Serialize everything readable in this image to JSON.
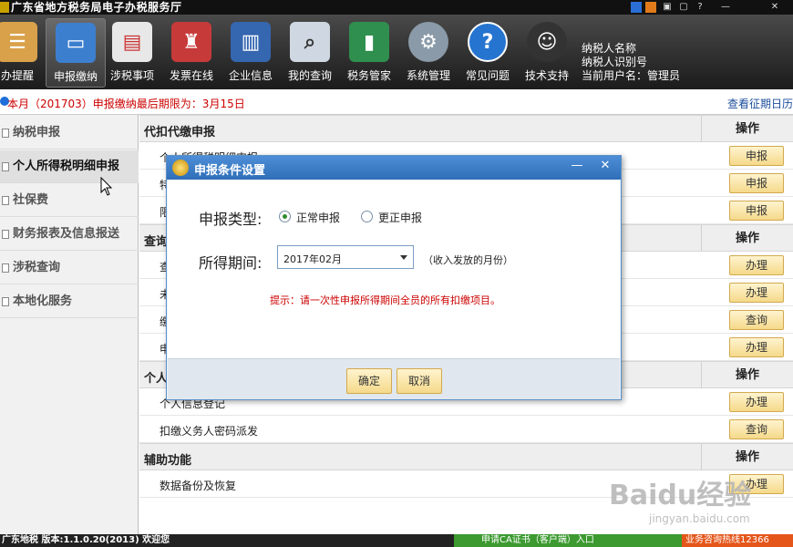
{
  "window": {
    "title": "广东省地方税务局电子办税服务厅",
    "controls": [
      "■",
      "■",
      "▣",
      "▢",
      "?",
      "—",
      "✕"
    ]
  },
  "toolbar": {
    "items": [
      {
        "label": "办提醒",
        "icon": "clipboard-icon"
      },
      {
        "label": "申报缴纳",
        "icon": "monitor-icon"
      },
      {
        "label": "涉税事项",
        "icon": "document-icon"
      },
      {
        "label": "发票在线",
        "icon": "stamp-icon"
      },
      {
        "label": "企业信息",
        "icon": "building-icon"
      },
      {
        "label": "我的查询",
        "icon": "magnifier-icon"
      },
      {
        "label": "税务管家",
        "icon": "bar-chart-icon"
      },
      {
        "label": "系统管理",
        "icon": "gear-icon"
      },
      {
        "label": "常见问题",
        "icon": "help-icon"
      },
      {
        "label": "技术支持",
        "icon": "support-agent-icon"
      }
    ],
    "active_index": 1
  },
  "user": {
    "line1": "纳税人名称",
    "line2": "纳税人识别号",
    "line3": "当前用户名：管理员"
  },
  "notice": {
    "text": "本月（201703）申报缴纳最后期限为：3月15日",
    "link": "查看征期日历"
  },
  "sidebar": {
    "items": [
      {
        "label": "纳税申报"
      },
      {
        "label": "个人所得税明细申报"
      },
      {
        "label": "社保费"
      },
      {
        "label": "财务报表及信息报送"
      },
      {
        "label": "涉税查询"
      },
      {
        "label": "本地化服务"
      }
    ],
    "active_index": 1
  },
  "content": {
    "sections": [
      {
        "title": "代扣代缴申报",
        "op": "操作",
        "rows": [
          {
            "text": "个人所得税明细申报",
            "btn": "申报"
          },
          {
            "text": "特",
            "btn": "申报"
          },
          {
            "text": "限",
            "btn": "申报"
          }
        ]
      },
      {
        "title": "查询",
        "op": "操作",
        "rows": [
          {
            "text": "查",
            "btn": "办理"
          },
          {
            "text": "未",
            "btn": "办理"
          },
          {
            "text": "缴",
            "btn": "查询"
          },
          {
            "text": "申",
            "btn": "办理"
          }
        ]
      },
      {
        "title": "个人",
        "op": "操作",
        "rows": [
          {
            "text": "个人信息登记",
            "btn": "办理"
          },
          {
            "text": "扣缴义务人密码派发",
            "btn": "查询"
          }
        ]
      },
      {
        "title": "辅助功能",
        "op": "操作",
        "rows": [
          {
            "text": "数据备份及恢复",
            "btn": "办理"
          }
        ]
      }
    ]
  },
  "dialog": {
    "title": "申报条件设置",
    "type_label": "申报类型:",
    "options": [
      "正常申报",
      "更正申报"
    ],
    "selected_option": 0,
    "period_label": "所得期间:",
    "period_value": "2017年02月",
    "period_hint": "（收入发放的月份）",
    "tip": "提示：请一次性申报所得期间全员的所有扣缴项目。",
    "ok": "确定",
    "cancel": "取消"
  },
  "statusbar": {
    "left": "广东地税 版本:1.1.0.20(2013) 欢迎您",
    "middle": "申请CA证书（客户端）入口",
    "right": "业务咨询热线12366"
  },
  "watermark": {
    "line1": "Baidu经验",
    "line2": "jingyan.baidu.com"
  },
  "colors": {
    "toolbar_bg": "#2a2a2a",
    "dialog_title": "#3a7bc8",
    "button_gold": "#f5d98a",
    "tip_red": "#cc0000",
    "status_green": "#3c9a30",
    "status_orange": "#e4561a"
  }
}
